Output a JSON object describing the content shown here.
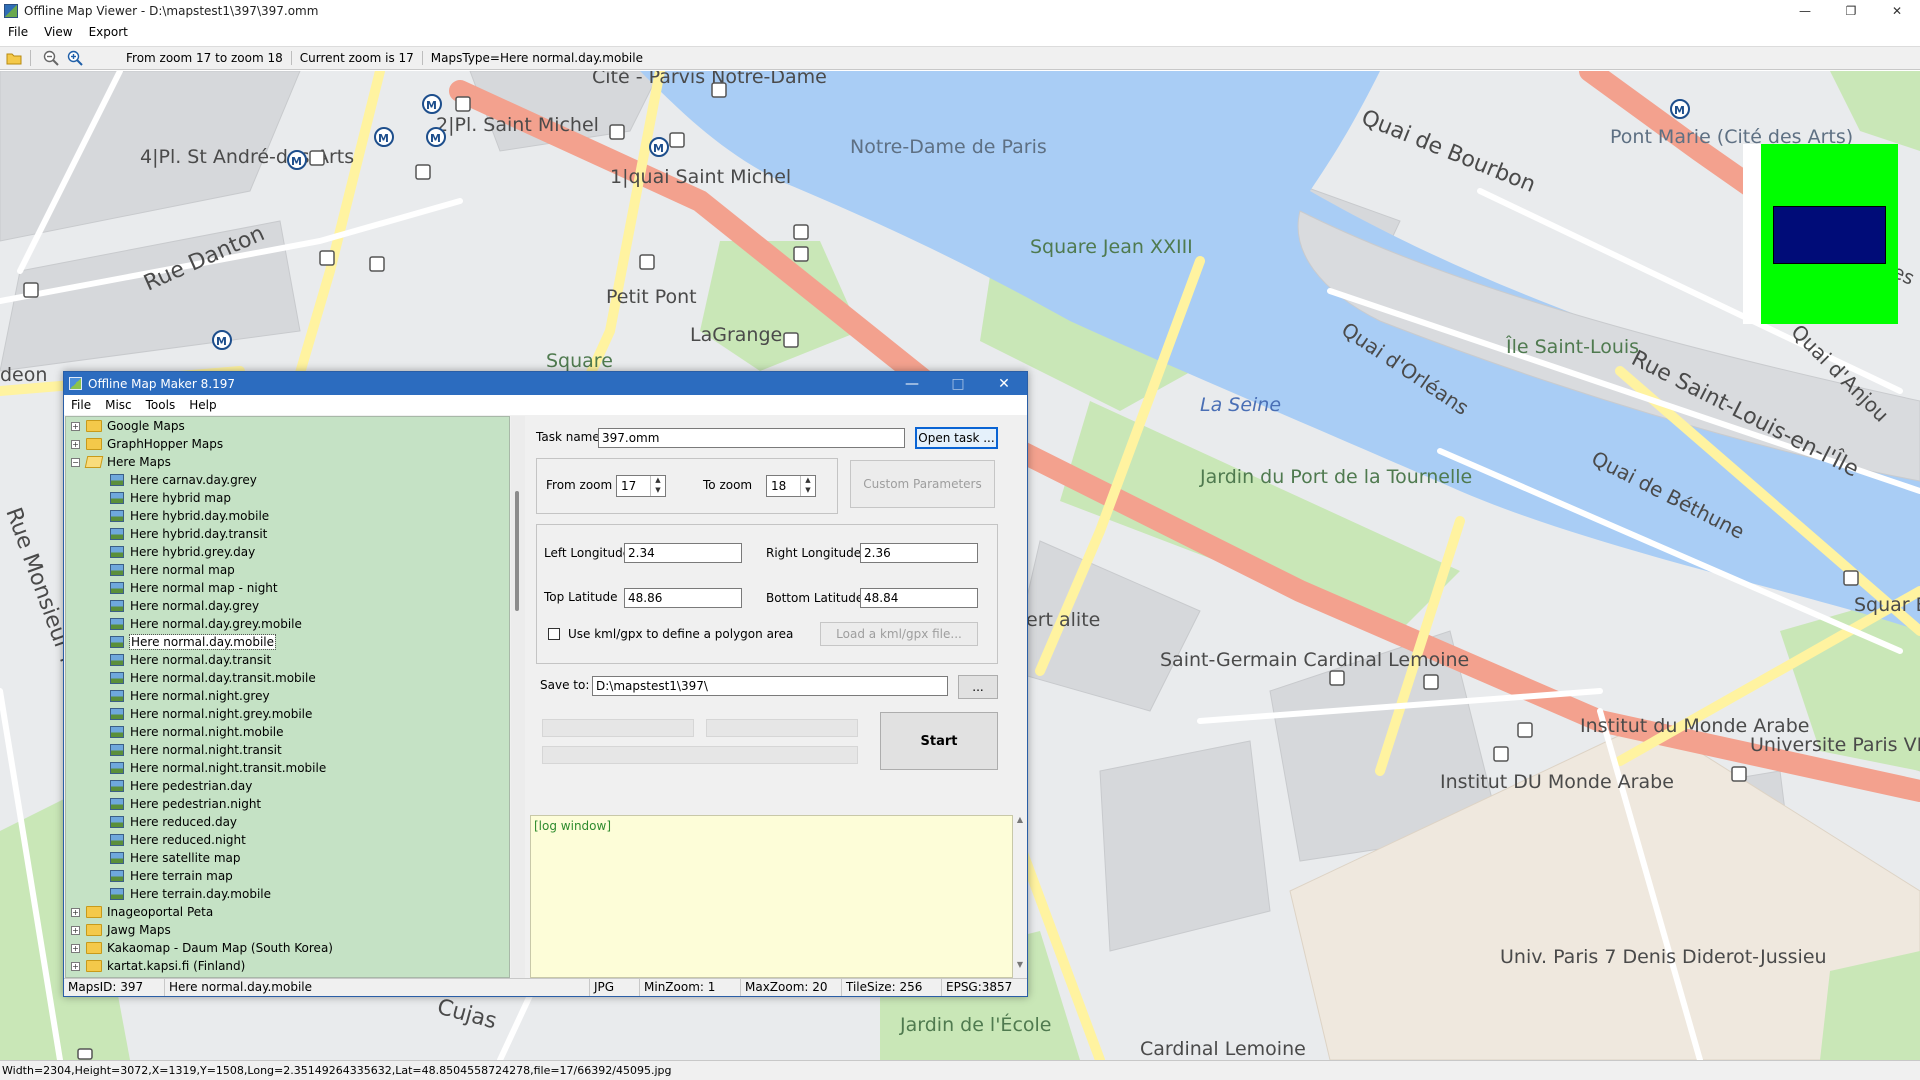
{
  "viewer": {
    "title": "Offline Map Viewer - D:\\mapstest1\\397\\397.omm",
    "menu": [
      "File",
      "View",
      "Export"
    ],
    "toolbar": {
      "zoom_range": "From zoom 17 to zoom 18",
      "current_zoom": "Current zoom is 17",
      "maps_type": "MapsType=Here normal.day.mobile"
    },
    "status": "Width=2304,Height=3072,X=1319,Y=1508,Long=2.35149264335632,Lat=48.8504558724278,file=17/66392/45095.jpg"
  },
  "map": {
    "labels": [
      "Cité - Parvis Notre-Dame",
      "4|Pl. St André-des-Arts",
      "2|Pl. Saint Michel",
      "1|quai Saint Michel",
      "Notre-Dame de Paris",
      "Quai de Bourbon",
      "Pont Marie (Cité des Arts)",
      "Rue Danton",
      "Square Jean XXIII",
      "Petit Pont",
      "LaGrange",
      "Square",
      "Île Saint-Louis",
      "Quai d'Orléans",
      "La Seine",
      "Rue Saint-Louis-en-l'Île",
      "Quai de Béthune",
      "Quai d'Anjou",
      "Jardin du Port de la Tournelle",
      "Saint-Germain Cardinal Lemoine",
      "Institut du Monde Arabe",
      "Institut DU Monde Arabe",
      "Universite Paris VI",
      "Univ. Paris 7 Denis Diderot-Jussieu",
      "Jardin de l'École",
      "Cardinal Lemoine",
      "Rue Monsieur le",
      "Cujas",
      "ert alite",
      "deon",
      "Squar Barye",
      "des"
    ],
    "colors": {
      "water": "#a9cdf5",
      "park": "#c8e6b5",
      "major_road": "#f5a08c",
      "road": "#fff7b0",
      "block": "#d8dadc"
    }
  },
  "maker": {
    "title": "Offline Map Maker 8.197",
    "menu": [
      "File",
      "Misc",
      "Tools",
      "Help"
    ],
    "tree": [
      {
        "label": "Google Maps",
        "type": "folder",
        "expanded": false
      },
      {
        "label": "GraphHopper Maps",
        "type": "folder",
        "expanded": false
      },
      {
        "label": "Here Maps",
        "type": "folder",
        "expanded": true
      },
      {
        "label": "Here carnav.day.grey",
        "type": "map"
      },
      {
        "label": "Here hybrid map",
        "type": "map"
      },
      {
        "label": "Here hybrid.day.mobile",
        "type": "map"
      },
      {
        "label": "Here hybrid.day.transit",
        "type": "map"
      },
      {
        "label": "Here hybrid.grey.day",
        "type": "map"
      },
      {
        "label": "Here normal map",
        "type": "map"
      },
      {
        "label": "Here normal map - night",
        "type": "map"
      },
      {
        "label": "Here normal.day.grey",
        "type": "map"
      },
      {
        "label": "Here normal.day.grey.mobile",
        "type": "map"
      },
      {
        "label": "Here normal.day.mobile",
        "type": "map",
        "selected": true
      },
      {
        "label": "Here normal.day.transit",
        "type": "map"
      },
      {
        "label": "Here normal.day.transit.mobile",
        "type": "map"
      },
      {
        "label": "Here normal.night.grey",
        "type": "map"
      },
      {
        "label": "Here normal.night.grey.mobile",
        "type": "map"
      },
      {
        "label": "Here normal.night.mobile",
        "type": "map"
      },
      {
        "label": "Here normal.night.transit",
        "type": "map"
      },
      {
        "label": "Here normal.night.transit.mobile",
        "type": "map"
      },
      {
        "label": "Here pedestrian.day",
        "type": "map"
      },
      {
        "label": "Here pedestrian.night",
        "type": "map"
      },
      {
        "label": "Here reduced.day",
        "type": "map"
      },
      {
        "label": "Here reduced.night",
        "type": "map"
      },
      {
        "label": "Here satellite map",
        "type": "map"
      },
      {
        "label": "Here terrain map",
        "type": "map"
      },
      {
        "label": "Here terrain.day.mobile",
        "type": "map"
      },
      {
        "label": "Inageoportal Peta",
        "type": "folder",
        "expanded": false
      },
      {
        "label": "Jawg Maps",
        "type": "folder",
        "expanded": false
      },
      {
        "label": "Kakaomap - Daum Map (South Korea)",
        "type": "folder",
        "expanded": false
      },
      {
        "label": "kartat.kapsi.fi (Finland)",
        "type": "folder",
        "expanded": false
      }
    ],
    "form": {
      "task_name_label": "Task name",
      "task_name_value": "397.omm",
      "open_task_button": "Open task ...",
      "from_zoom_label": "From zoom",
      "from_zoom_value": "17",
      "to_zoom_label": "To zoom",
      "to_zoom_value": "18",
      "custom_params_button": "Custom Parameters",
      "left_lon_label": "Left Longitude",
      "left_lon_value": "2.34",
      "right_lon_label": "Right Longitude",
      "right_lon_value": "2.36",
      "top_lat_label": "Top Latitude",
      "top_lat_value": "48.86",
      "bottom_lat_label": "Bottom Latitude",
      "bottom_lat_value": "48.84",
      "kml_checkbox_label": "Use kml/gpx to define a polygon area",
      "load_kml_button": "Load a kml/gpx file...",
      "save_to_label": "Save to:",
      "save_to_value": "D:\\mapstest1\\397\\",
      "browse_button": "...",
      "start_button": "Start"
    },
    "log": "[log window]",
    "status": {
      "maps_id": "MapsID: 397",
      "map_name": "Here normal.day.mobile",
      "format": "JPG",
      "min_zoom": "MinZoom: 1",
      "max_zoom": "MaxZoom: 20",
      "tile_size": "TileSize: 256",
      "epsg": "EPSG:3857"
    }
  }
}
